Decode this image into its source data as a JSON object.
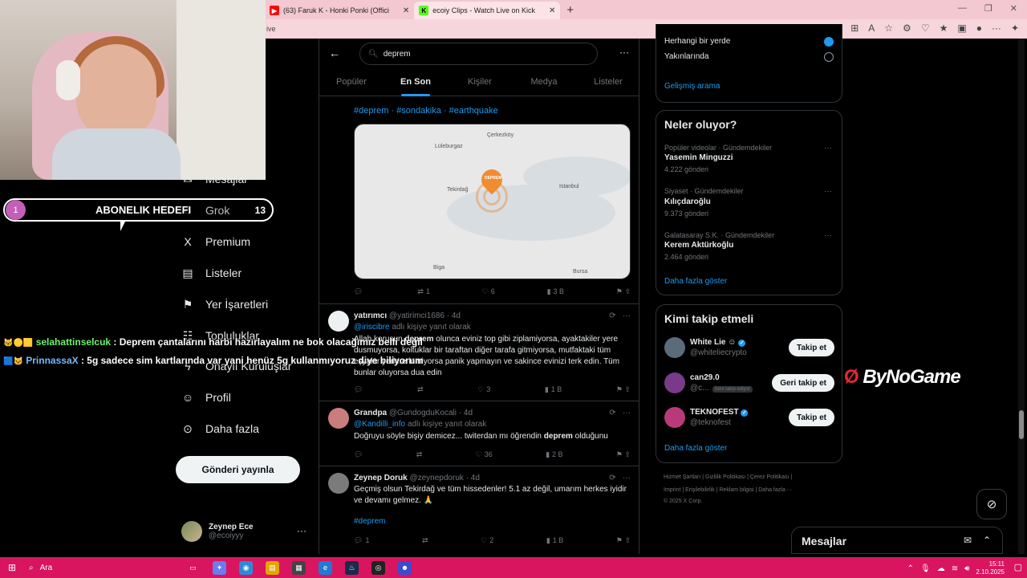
{
  "browser": {
    "tabs": [
      {
        "label": "(63) Faruk K - Honki Ponki (Offici",
        "fav": "▶",
        "fav_color": "#ff0000"
      },
      {
        "label": "ecoiy Clips - Watch Live on Kick",
        "fav": "K",
        "fav_color": "#53fc18"
      }
    ],
    "address": "ive"
  },
  "overlay": {
    "goal_level": "1",
    "goal_label": "ABONELIK HEDEFI",
    "goal_count": "13",
    "chat": [
      {
        "badges": "🐱🟡🟨",
        "user": "selahattinselcuk",
        "text": ": Deprem çantalarını harbi hazırlayalım ne bok olacağımız belli değil"
      },
      {
        "badges": "🟦🐱",
        "user": "PrinnassaX",
        "text": ": 5g sadece sim kartlarında var yani henüz 5g kullanmıyoruz diye biliyorum"
      }
    ]
  },
  "nav": {
    "items": [
      {
        "label": "Mesajlar",
        "icon": "✉"
      },
      {
        "label": "Grok",
        "icon": "◌"
      },
      {
        "label": "Premium",
        "icon": "X"
      },
      {
        "label": "Listeler",
        "icon": "▤"
      },
      {
        "label": "Yer İşaretleri",
        "icon": "⚑"
      },
      {
        "label": "Topluluklar",
        "icon": "☷"
      },
      {
        "label": "Onaylı Kuruluşlar",
        "icon": "ϟ"
      },
      {
        "label": "Profil",
        "icon": "☺"
      },
      {
        "label": "Daha fazla",
        "icon": "⊙"
      }
    ],
    "post_label": "Gönderi yayınla",
    "profile_name": "Zeynep Ece",
    "profile_handle": "@ecoiyyy"
  },
  "search": {
    "query": "deprem",
    "tabs": [
      "Popüler",
      "En Son",
      "Kişiler",
      "Medya",
      "Listeler"
    ],
    "active_tab": "En Son"
  },
  "first_post": {
    "hashtags": "#deprem · #sondakika · #earthquake",
    "map_labels": [
      "Lüleburgaz",
      "Çerkezköy",
      "Tekirdağ",
      "Istanbul",
      "Biga",
      "Bursa",
      "DEPREM"
    ],
    "reply": "",
    "repost": "1",
    "like": "6",
    "views": "3 B"
  },
  "tweets": [
    {
      "name": "yatırımcı",
      "handle": "@yatirimci1686 · 4d",
      "reply_mention": "@iriscibre",
      "reply_suffix": " adlı kişiye yanıt olarak",
      "text_prefix": "Allah korusun ",
      "bold": "deprem",
      "text_suffix": " olunca eviniz top gibi ziplamiyorsa, ayaktakiler yere dusmuyorsa, koltuklar bir taraftan diğer tarafa gitmiyorsa, mutfaktaki tüm eşyalar yerlere inmiyorsa panik yapmayın ve sakince evinizi terk edin. Tüm bunlar oluyorsa dua edin",
      "reply": "",
      "repost": "",
      "like": "3",
      "views": "1 B"
    },
    {
      "name": "Grandpa",
      "handle": "@GundogduKocali · 4d",
      "reply_mention": "@Kandilli_info",
      "reply_suffix": " adlı kişiye yanıt olarak",
      "text_prefix": "Doğruyu söyle bişiy demicez... twiterdan mı öğrendin ",
      "bold": "deprem",
      "text_suffix": " olduğunu",
      "reply": "",
      "repost": "",
      "like": "36",
      "views": "2 B"
    },
    {
      "name": "Zeynep Doruk",
      "handle": "@zeynepdoruk · 4d",
      "text": "Geçmiş olsun Tekirdağ ve tüm hissedenler! 5.1 az değil, umarım herkes iyidir ve devamı gelmez. 🙏",
      "hashtag": "#deprem",
      "reply": "1",
      "repost": "",
      "like": "2",
      "views": "1 B"
    }
  ],
  "location_filter": {
    "option1": "Herhangi bir yerde",
    "option2": "Yakınlarında",
    "advanced": "Gelişmiş arama"
  },
  "trends": {
    "title": "Neler oluyor?",
    "items": [
      {
        "category": "Popüler videolar · Gündemdekiler",
        "name": "Yasemin Minguzzi",
        "count": "4.222 gönderi"
      },
      {
        "category": "Siyaset · Gündemdekiler",
        "name": "Kılıçdaroğlu",
        "count": "9.373 gönderi"
      },
      {
        "category": "Galatasaray S.K. · Gündemdekiler",
        "name": "Kerem Aktürkoğlu",
        "count": "2.464 gönderi"
      }
    ],
    "show_more": "Daha fazla göster"
  },
  "who_to_follow": {
    "title": "Kimi takip etmeli",
    "items": [
      {
        "name": "White Lie ☺",
        "handle": "@whiteliecrypto",
        "button": "Takip et",
        "verified": true
      },
      {
        "name": "can29.0",
        "handle": "@c...",
        "badge": "Seni takip ediyor",
        "button": "Geri takip et",
        "verified": false
      },
      {
        "name": "TEKNOFEST",
        "handle": "@teknofest",
        "button": "Takip et",
        "verified": true
      }
    ],
    "show_more": "Daha fazla göster"
  },
  "footer": {
    "line1": "Hizmet Şartları   |   Gizlilik Politikası   |   Çerez Politikası   |",
    "line2": "Imprint   |   Erişilebilirlik   |   Reklam bilgisi   |   Daha fazla ···",
    "line3": "© 2025 X Corp."
  },
  "brand": "ByNoGame",
  "messages_drawer": "Mesajlar",
  "taskbar": {
    "search": "Ara",
    "time": "15:11",
    "date": "2.10.2025"
  }
}
